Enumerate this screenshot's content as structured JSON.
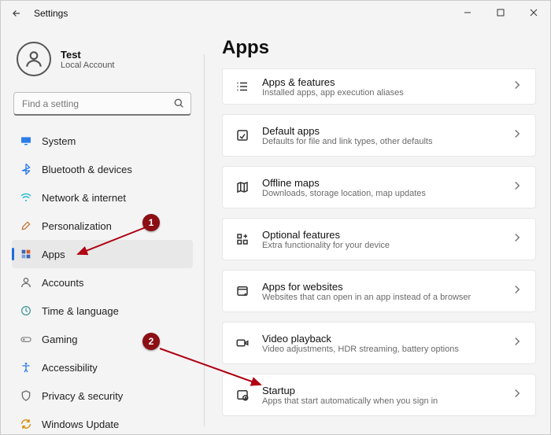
{
  "window": {
    "title": "Settings"
  },
  "account": {
    "name": "Test",
    "type": "Local Account"
  },
  "search": {
    "placeholder": "Find a setting"
  },
  "sidebar": {
    "items": [
      {
        "id": "system",
        "label": "System",
        "icon": "display-icon",
        "color": "#2b7de9",
        "selected": false
      },
      {
        "id": "bluetooth",
        "label": "Bluetooth & devices",
        "icon": "bluetooth-icon",
        "color": "#2b7de9",
        "selected": false
      },
      {
        "id": "network",
        "label": "Network & internet",
        "icon": "wifi-icon",
        "color": "#18b6c9",
        "selected": false
      },
      {
        "id": "personalization",
        "label": "Personalization",
        "icon": "brush-icon",
        "color": "#c27a3d",
        "selected": false
      },
      {
        "id": "apps",
        "label": "Apps",
        "icon": "apps-icon",
        "color": "#3a66b7",
        "selected": true
      },
      {
        "id": "accounts",
        "label": "Accounts",
        "icon": "person-icon",
        "color": "#6e6e6e",
        "selected": false
      },
      {
        "id": "time",
        "label": "Time & language",
        "icon": "globe-clock-icon",
        "color": "#4a9a9a",
        "selected": false
      },
      {
        "id": "gaming",
        "label": "Gaming",
        "icon": "gamepad-icon",
        "color": "#8a8a8a",
        "selected": false
      },
      {
        "id": "accessibility",
        "label": "Accessibility",
        "icon": "accessibility-icon",
        "color": "#2b7de9",
        "selected": false
      },
      {
        "id": "privacy",
        "label": "Privacy & security",
        "icon": "shield-icon",
        "color": "#6e6e6e",
        "selected": false
      },
      {
        "id": "update",
        "label": "Windows Update",
        "icon": "update-icon",
        "color": "#d98a00",
        "selected": false
      }
    ]
  },
  "main": {
    "title": "Apps",
    "cards": [
      {
        "id": "apps-features",
        "title": "Apps & features",
        "sub": "Installed apps, app execution aliases",
        "icon": "list-icon",
        "first": true
      },
      {
        "id": "default-apps",
        "title": "Default apps",
        "sub": "Defaults for file and link types, other defaults",
        "icon": "default-apps-icon"
      },
      {
        "id": "offline-maps",
        "title": "Offline maps",
        "sub": "Downloads, storage location, map updates",
        "icon": "map-icon"
      },
      {
        "id": "optional-features",
        "title": "Optional features",
        "sub": "Extra functionality for your device",
        "icon": "plus-grid-icon"
      },
      {
        "id": "apps-for-websites",
        "title": "Apps for websites",
        "sub": "Websites that can open in an app instead of a browser",
        "icon": "web-app-icon"
      },
      {
        "id": "video-playback",
        "title": "Video playback",
        "sub": "Video adjustments, HDR streaming, battery options",
        "icon": "video-icon"
      },
      {
        "id": "startup",
        "title": "Startup",
        "sub": "Apps that start automatically when you sign in",
        "icon": "startup-icon"
      }
    ]
  },
  "annotations": [
    {
      "num": "1"
    },
    {
      "num": "2"
    }
  ]
}
